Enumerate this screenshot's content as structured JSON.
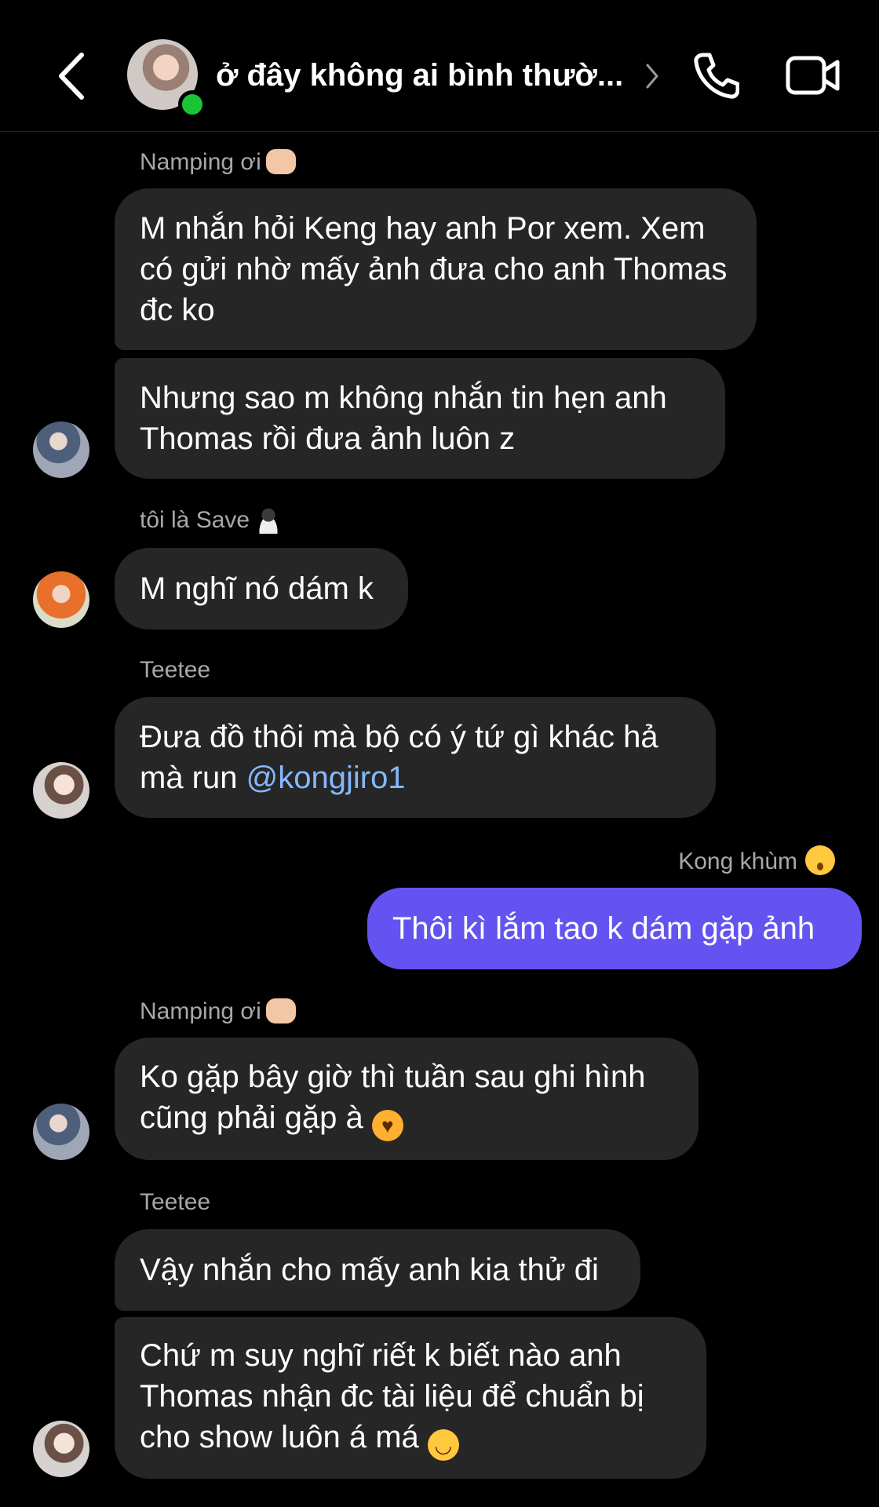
{
  "header": {
    "title": "ở đây không ai bình thườ...",
    "online": true
  },
  "messages": [
    {
      "sender": "Namping ơi",
      "bubbles": [
        "M nhắn hỏi Keng hay anh Por xem. Xem có gửi nhờ mấy ảnh đưa cho anh Thomas đc ko",
        "Nhưng sao m không nhắn tin hẹn anh Thomas rồi đưa ảnh luôn z"
      ]
    },
    {
      "sender": "tôi là Save",
      "bubbles": [
        "M nghĩ nó dám k"
      ]
    },
    {
      "sender": "Teetee",
      "text": "Đưa đồ thôi mà bộ có ý tứ gì khác hả mà run",
      "mention": "@kongjiro1"
    },
    {
      "sender": "Kong khùm",
      "outgoing": true,
      "bubbles": [
        "Thôi kì lắm tao k dám gặp ảnh"
      ]
    },
    {
      "sender": "Namping ơi",
      "bubbles": [
        "Ko gặp bây giờ thì tuần sau ghi hình cũng phải gặp à"
      ]
    },
    {
      "sender": "Teetee",
      "bubbles": [
        "Vậy nhắn cho mấy anh kia thử đi",
        "Chứ m suy nghĩ riết k biết nào anh Thomas nhận đc tài liệu để chuẩn bị cho show luôn á má"
      ]
    }
  ],
  "icons": {
    "back": "chevron-left-icon",
    "call": "phone-icon",
    "video": "video-camera-icon",
    "emoji_smiling_hearts": "smiling-face-with-hearts-emoji",
    "emoji_melting": "melting-face-emoji"
  },
  "colors": {
    "background": "#000000",
    "incoming_bubble": "#262626",
    "outgoing_bubble": "#6553f1",
    "mention": "#85b8ff",
    "online": "#19c537",
    "sender_name": "#a8a8a8"
  }
}
